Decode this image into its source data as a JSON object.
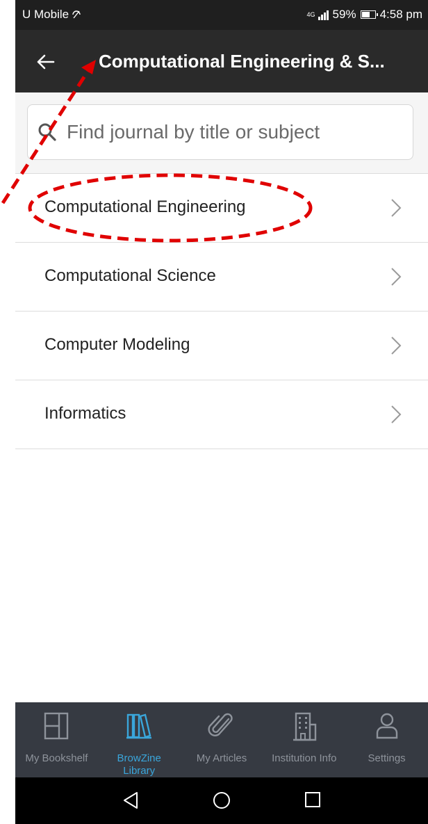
{
  "status_bar": {
    "carrier": "U Mobile",
    "network": "4G",
    "battery_percent": "59%",
    "time": "4:58 pm"
  },
  "app_bar": {
    "title": "Computational Engineering & S..."
  },
  "search": {
    "placeholder": "Find journal by title or subject"
  },
  "subjects": [
    {
      "label": "Computational Engineering"
    },
    {
      "label": "Computational Science"
    },
    {
      "label": "Computer Modeling"
    },
    {
      "label": "Informatics"
    }
  ],
  "bottom_nav": {
    "items": [
      {
        "label": "My Bookshelf",
        "icon": "bookshelf-icon",
        "active": false
      },
      {
        "label": "BrowZine Library",
        "icon": "library-icon",
        "active": true
      },
      {
        "label": "My Articles",
        "icon": "paperclip-icon",
        "active": false
      },
      {
        "label": "Institution Info",
        "icon": "building-icon",
        "active": false
      },
      {
        "label": "Settings",
        "icon": "person-icon",
        "active": false
      }
    ]
  },
  "colors": {
    "app_bar": "#2a2a2a",
    "nav_bg": "#363a42",
    "nav_active": "#3aa6db",
    "annotation": "#e00000"
  }
}
